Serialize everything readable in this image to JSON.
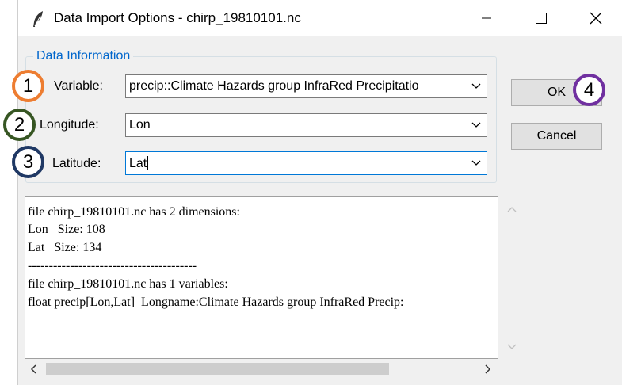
{
  "window": {
    "title": "Data Import Options - chirp_19810101.nc"
  },
  "group": {
    "legend": "Data Information"
  },
  "fields": {
    "variable": {
      "label": "Variable:",
      "value": "precip::Climate Hazards group InfraRed Precipitatio"
    },
    "longitude": {
      "label": "Longitude:",
      "value": "Lon"
    },
    "latitude": {
      "label": "Latitude:",
      "value": "Lat"
    }
  },
  "buttons": {
    "ok": "OK",
    "cancel": "Cancel"
  },
  "info_lines": [
    "file chirp_19810101.nc has 2 dimensions:",
    "Lon   Size: 108",
    "Lat   Size: 134",
    "----------------------------------------",
    "file chirp_19810101.nc has 1 variables:",
    "float precip[Lon,Lat]  Longname:Climate Hazards group InfraRed Precip:"
  ],
  "annotations": [
    {
      "number": "1",
      "color": "#ed7d31"
    },
    {
      "number": "2",
      "color": "#375623"
    },
    {
      "number": "3",
      "color": "#1f3864"
    },
    {
      "number": "4",
      "color": "#7030a0"
    }
  ],
  "icons": {
    "app": "feather-icon",
    "minimize": "minimize-icon",
    "maximize": "maximize-icon",
    "close": "close-icon",
    "dropdown": "chevron-down-icon",
    "scroll_up": "chevron-up-icon",
    "scroll_down": "chevron-down-icon",
    "scroll_left": "chevron-left-icon",
    "scroll_right": "chevron-right-icon"
  }
}
